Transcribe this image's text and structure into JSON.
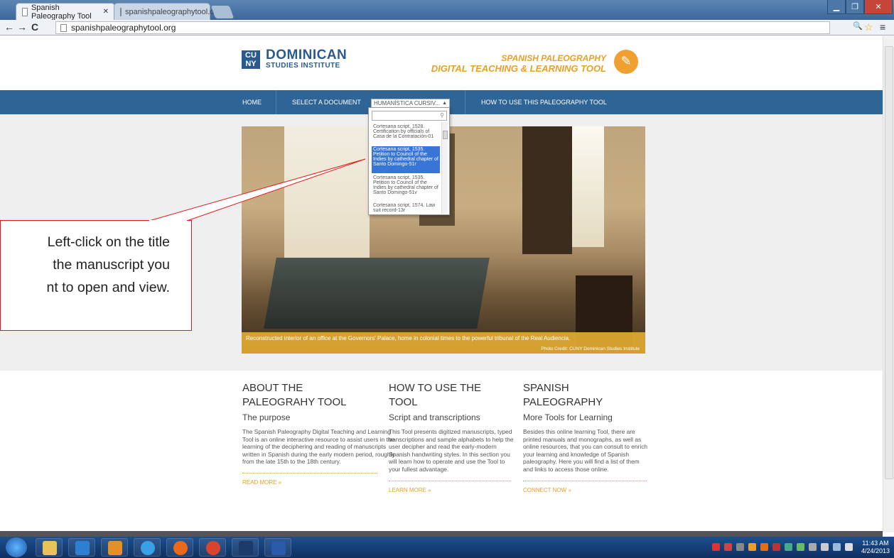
{
  "browser": {
    "tabs": [
      {
        "title": "Spanish Paleography Tool"
      },
      {
        "title": "spanishpaleographytool.o"
      }
    ],
    "url": "spanishpaleographytool.org"
  },
  "header": {
    "cuny_logo": "CU NY",
    "institute_line1": "DOMINICAN",
    "institute_line2": "STUDIES INSTITUTE",
    "tool_title_line1": "SPANISH PALEOGRAPHY",
    "tool_title_line2": "DIGITAL TEACHING & LEARNING TOOL"
  },
  "nav": {
    "home": "HOME",
    "select_doc": "SELECT A DOCUMENT",
    "select_value": "HUMANÍSTICA CURSIV...",
    "how_to": "HOW TO USE THIS PALEOGRAPHY TOOL"
  },
  "dropdown": {
    "search_value": "",
    "options": [
      {
        "label": "Cortesana script, 1528. Certification by officials of Casa de la Contratación-01",
        "selected": false
      },
      {
        "label": "Cortesana script, 1535. Petition to Council of the Indies by cathedral chapter of Santo Domingo-51r",
        "selected": true
      },
      {
        "label": "Cortesana script, 1535. Petition to Council of the Indies by cathedral chapter of Santo Domingo-51v",
        "selected": false
      },
      {
        "label": "Cortesana script, 1574. Law suit record-13r",
        "selected": false
      }
    ]
  },
  "hero": {
    "caption": "Reconstructed interior of an office at the Governors' Palace, home in colonial times to the powerful tribunal of the Real Audiencia.",
    "credit": "Photo Credit: CUNY Dominican Studies Institute"
  },
  "callout": {
    "line1": "Left-click on the title",
    "line2": "the manuscript you",
    "line3": "nt to open and view."
  },
  "columns": [
    {
      "title_line1": "ABOUT THE",
      "title_line2": "PALEOGRAHY TOOL",
      "subtitle": "The purpose",
      "body": "The Spanish Paleography Digital Teaching and Learning Tool is an online interactive resource to assist users in the learning of the deciphering and reading of manuscripts written in Spanish during the early modern period, roughly from the late 15th to the 18th century.",
      "link": "READ MORE »"
    },
    {
      "title_line1": "HOW TO USE THE",
      "title_line2": "TOOL",
      "subtitle": "Script and transcriptions",
      "body": "This Tool presents digitized manuscripts, typed transcriptions and sample alphabets to help the user decipher and read the early-modern Spanish handwriting styles. In this section you will learn how to operate and use the Tool to your fullest advantage.",
      "link": "LEARN MORE »"
    },
    {
      "title_line1": "SPANISH",
      "title_line2": "PALEOGRAPHY",
      "subtitle": "More Tools for Learning",
      "body": "Besides this online learning Tool, there are printed manuals and monographs, as well as online resources, that you can consult to enrich your learning and knowledge of Spanish paleography. Here you will find a list of them and links to access those online.",
      "link": "CONNECT NOW »"
    }
  ],
  "taskbar": {
    "time": "11:43 AM",
    "date": "4/24/2013",
    "apps": [
      "explorer-icon",
      "media-player-icon",
      "outlook-icon",
      "ie-icon",
      "firefox-icon",
      "chrome-icon",
      "photoshop-icon",
      "word-icon"
    ]
  },
  "colors": {
    "nav": "#2e6496",
    "accent": "#e8a028",
    "brand": "#2a5a8e",
    "select": "#3875d7"
  }
}
